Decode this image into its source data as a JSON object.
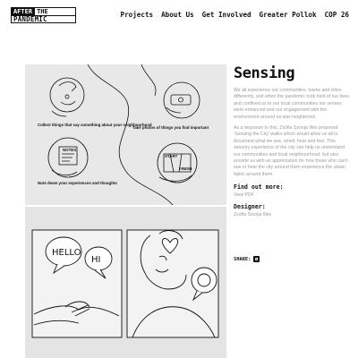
{
  "logo": {
    "word1": "AFTER",
    "word2": "THE",
    "word3": "PANDEMIC"
  },
  "nav": {
    "projects": "Projects",
    "about": "About Us",
    "involved": "Get Involved",
    "pollok": "Greater Pollok",
    "cop": "COP 26"
  },
  "illustration1": {
    "collect": "Collect things that say something about your neighbourhood",
    "photos": "Take photos of things you find important",
    "note": "Note down your experiences and thoughts",
    "notes_label": "NOTES",
    "start": "START",
    "finish": "FINISH"
  },
  "illustration2": {
    "bubble1": "HELLO",
    "bubble2": "HI"
  },
  "project": {
    "title": "Sensing",
    "para1": "We all experience our communities, towns and cities differently, and when the pandemic took hold of our lives and confined us to our local communities our senses were enhanced and our engagement with the environment around us was heightened.",
    "para2": "As a response to this, Zsófia Szonja Illés proposed ‘Sensing the City’ walks which would allow us all to document what we see, smell, hear and feel. This sensory experience of the city can help us understand our communities and local neighbourhood, but also provide us with an appreciation for how those who can't see or hear the city around them experience the urban fabric around them."
  },
  "find_out": {
    "heading": "Find out more:",
    "link": "View PDF"
  },
  "designer": {
    "heading": "Designer:",
    "name": "Zsófia Szonja Illés"
  },
  "share": {
    "label": "SHARE:",
    "icon": "twitter-icon"
  }
}
